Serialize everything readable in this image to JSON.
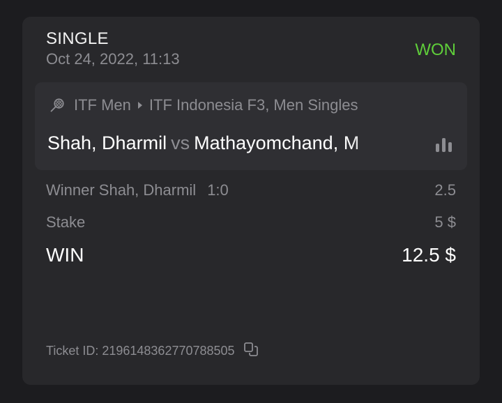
{
  "bet": {
    "type": "SINGLE",
    "date": "Oct 24, 2022, 11:13",
    "status": "WON",
    "status_color": "#5fce3a"
  },
  "event": {
    "sport_icon": "tennis-racket-icon",
    "category": "ITF Men",
    "tournament": "ITF Indonesia F3, Men Singles",
    "player1": "Shah, Dharmil",
    "vs": "vs",
    "player2": "Mathayomchand, M",
    "stats_icon": "stats-bars-icon"
  },
  "selection": {
    "pick": "Winner Shah, Dharmil",
    "score": "1:0",
    "odds": "2.5"
  },
  "stake": {
    "label": "Stake",
    "value": "5 $"
  },
  "win": {
    "label": "WIN",
    "value": "12.5 $"
  },
  "ticket": {
    "label": "Ticket ID: 2196148362770788505",
    "copy_icon": "copy-icon"
  }
}
